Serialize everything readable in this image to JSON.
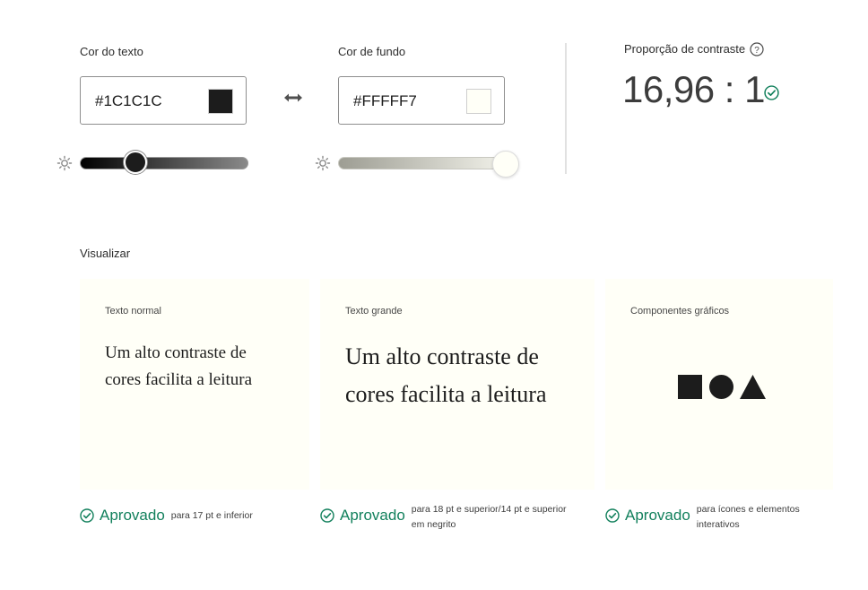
{
  "text_color": {
    "label": "Cor do texto",
    "value": "#1C1C1C",
    "swatch": "#1c1c1c",
    "lightness": 0.31
  },
  "swap_icon": "double-arrow-icon",
  "background_color": {
    "label": "Cor de fundo",
    "value": "#FFFFF7",
    "swatch": "#fffff7",
    "lightness": 1.0
  },
  "contrast": {
    "label": "Proporção de contraste",
    "help_icon": "help-circle-icon",
    "ratio": "16,96 : 1",
    "status_icon": "check-circle-icon"
  },
  "preview": {
    "heading": "Visualizar",
    "cards": [
      {
        "title": "Texto normal",
        "sample": "Um alto contraste de cores facilita a leitura",
        "status": "Aprovado",
        "note": "para 17 pt e inferior"
      },
      {
        "title": "Texto grande",
        "sample": "Um alto contraste de cores facilita a leitura",
        "status": "Aprovado",
        "note": "para 18 pt e superior/14 pt e superior em negrito"
      },
      {
        "title": "Componentes gráficos",
        "shapes": [
          "square",
          "circle",
          "triangle"
        ],
        "status": "Aprovado",
        "note": "para ícones e elementos interativos"
      }
    ]
  },
  "colors": {
    "accent_green": "#12805c",
    "border": "#8e8e8e"
  }
}
